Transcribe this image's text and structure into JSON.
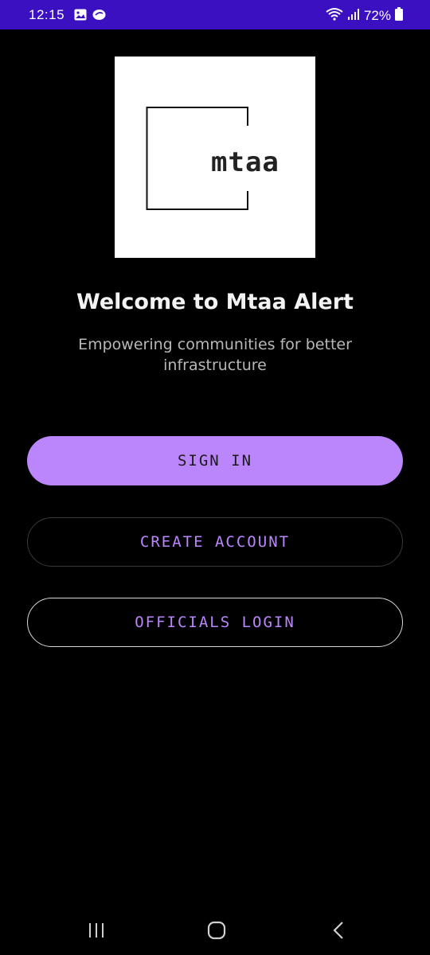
{
  "status_bar": {
    "time": "12:15",
    "battery": "72%"
  },
  "logo": {
    "text": "mtaa"
  },
  "welcome": {
    "title": "Welcome to Mtaa Alert",
    "subtitle": "Empowering communities for better infrastructure"
  },
  "buttons": {
    "sign_in": "SIGN IN",
    "create_account": "CREATE ACCOUNT",
    "officials_login": "OFFICIALS LOGIN"
  },
  "colors": {
    "status_bar": "#3a10c0",
    "accent": "#bb86fc",
    "background": "#000000"
  },
  "icons": {
    "status_left": [
      "gallery-icon",
      "cloud-icon"
    ],
    "status_right": [
      "wifi-icon",
      "signal-icon",
      "battery-icon"
    ],
    "nav": [
      "recent-apps-icon",
      "home-icon",
      "back-icon"
    ]
  }
}
